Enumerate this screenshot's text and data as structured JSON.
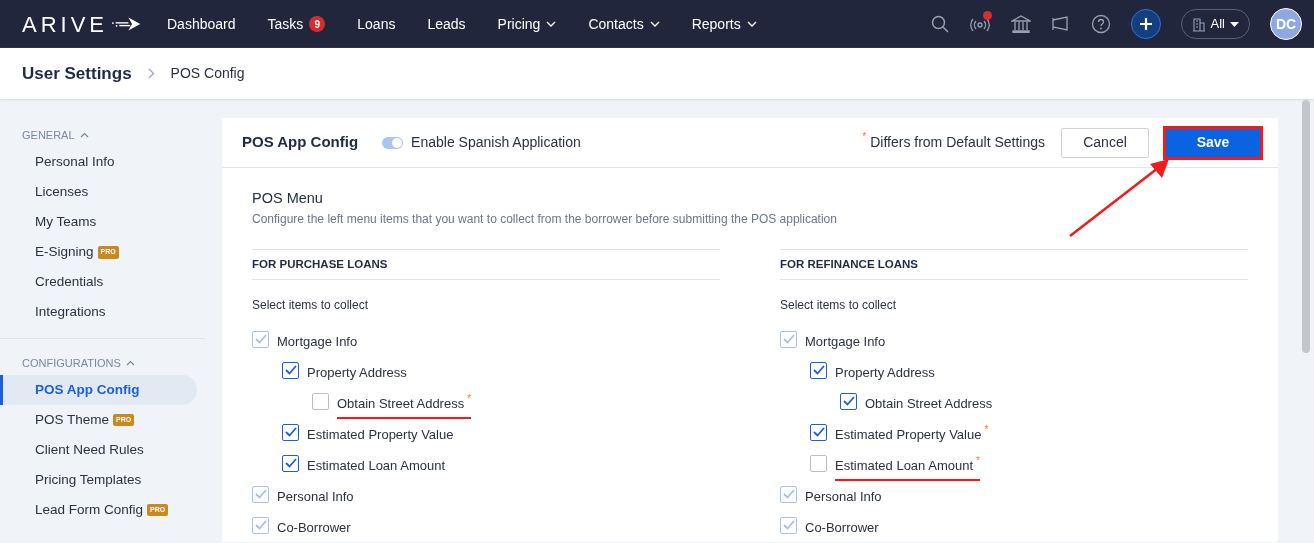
{
  "navbar": {
    "logo": "ARIVE",
    "items": [
      {
        "label": "Dashboard",
        "dropdown": false
      },
      {
        "label": "Tasks",
        "badge": "9",
        "dropdown": false
      },
      {
        "label": "Loans",
        "dropdown": false
      },
      {
        "label": "Leads",
        "dropdown": false
      },
      {
        "label": "Pricing",
        "dropdown": true
      },
      {
        "label": "Contacts",
        "dropdown": true
      },
      {
        "label": "Reports",
        "dropdown": true
      }
    ],
    "notification_dot": true,
    "company_filter": "All",
    "avatar": "DC"
  },
  "breadcrumb": [
    "User Settings",
    "POS Config"
  ],
  "sidebar": {
    "sections": [
      {
        "title": "GENERAL",
        "expanded": true,
        "items": [
          {
            "label": "Personal Info",
            "selected": false
          },
          {
            "label": "Licenses",
            "selected": false
          },
          {
            "label": "My Teams",
            "selected": false
          },
          {
            "label": "E-Signing",
            "pro": "PRO",
            "selected": false
          },
          {
            "label": "Credentials",
            "selected": false
          },
          {
            "label": "Integrations",
            "selected": false
          }
        ]
      },
      {
        "title": "CONFIGURATIONS",
        "expanded": true,
        "items": [
          {
            "label": "POS App Config",
            "selected": true
          },
          {
            "label": "POS Theme",
            "pro": "PRO",
            "selected": false
          },
          {
            "label": "Client Need Rules",
            "selected": false
          },
          {
            "label": "Pricing Templates",
            "selected": false
          },
          {
            "label": "Lead Form Config",
            "pro": "PRO",
            "selected": false
          }
        ]
      }
    ]
  },
  "header": {
    "title": "POS App Config",
    "toggle": {
      "label": "Enable Spanish Application",
      "on": true
    },
    "legend_mark": "*",
    "legend": "Differs from Default Settings",
    "buttons": [
      {
        "label": "Cancel",
        "kind": "secondary",
        "outlined": false
      },
      {
        "label": "Save",
        "kind": "primary",
        "outlined": true
      }
    ]
  },
  "menu": {
    "title": "POS Menu",
    "description": "Configure the left menu items that you want to collect from the borrower before submitting the POS application",
    "columns": [
      {
        "title": "FOR PURCHASE LOANS",
        "prompt": "Select items to collect",
        "items": [
          {
            "label": "Mortgage Info",
            "checked": true,
            "disabled": true,
            "differs": false,
            "underlined": false,
            "children": [
              {
                "label": "Property Address",
                "checked": true,
                "disabled": false,
                "differs": false,
                "underlined": false,
                "children": [
                  {
                    "label": "Obtain Street Address",
                    "checked": false,
                    "disabled": false,
                    "differs": true,
                    "underlined": true
                  }
                ]
              },
              {
                "label": "Estimated Property Value",
                "checked": true,
                "disabled": false,
                "differs": false,
                "underlined": false
              },
              {
                "label": "Estimated Loan Amount",
                "checked": true,
                "disabled": false,
                "differs": false,
                "underlined": false
              }
            ]
          },
          {
            "label": "Personal Info",
            "checked": true,
            "disabled": true,
            "differs": false,
            "underlined": false
          },
          {
            "label": "Co-Borrower",
            "checked": true,
            "disabled": true,
            "differs": false,
            "underlined": false
          }
        ]
      },
      {
        "title": "FOR REFINANCE LOANS",
        "prompt": "Select items to collect",
        "items": [
          {
            "label": "Mortgage Info",
            "checked": true,
            "disabled": true,
            "differs": false,
            "underlined": false,
            "children": [
              {
                "label": "Property Address",
                "checked": true,
                "disabled": false,
                "differs": false,
                "underlined": false,
                "children": [
                  {
                    "label": "Obtain Street Address",
                    "checked": true,
                    "disabled": false,
                    "differs": false,
                    "underlined": false
                  }
                ]
              },
              {
                "label": "Estimated Property Value",
                "checked": true,
                "disabled": false,
                "differs": true,
                "underlined": false
              },
              {
                "label": "Estimated Loan Amount",
                "checked": false,
                "disabled": false,
                "differs": true,
                "underlined": true
              }
            ]
          },
          {
            "label": "Personal Info",
            "checked": true,
            "disabled": true,
            "differs": false,
            "underlined": false
          },
          {
            "label": "Co-Borrower",
            "checked": true,
            "disabled": true,
            "differs": false,
            "underlined": false
          }
        ]
      }
    ]
  }
}
